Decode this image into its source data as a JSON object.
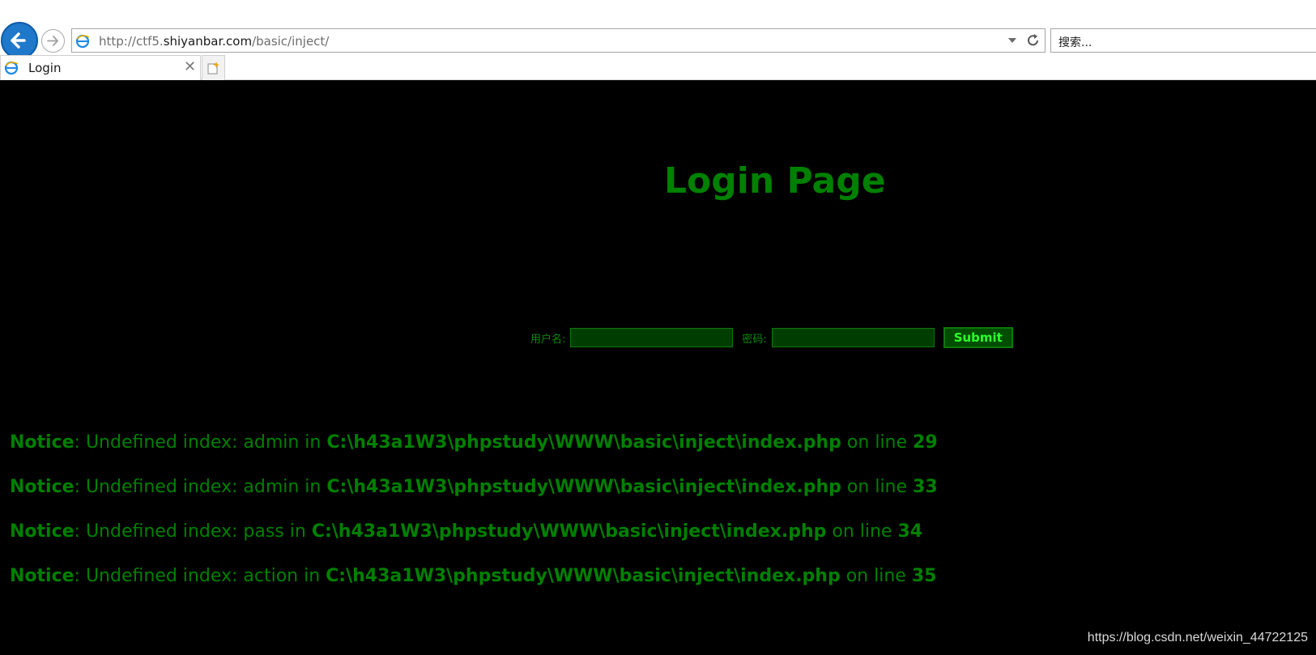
{
  "browser": {
    "address_prefix": "http://ctf5.",
    "address_host": "shiyanbar.com",
    "address_path": "/basic/inject/",
    "search_placeholder": "搜索...",
    "tab_title": "Login",
    "tab_close": "✕"
  },
  "page": {
    "title": "Login Page",
    "form": {
      "username_label": "用户名:",
      "username_value": "",
      "password_label": "密码:",
      "password_value": "",
      "submit_label": "Submit"
    },
    "notices": [
      {
        "label": "Notice",
        "text": ": Undefined index: admin in ",
        "path": "C:\\h43a1W3\\phpstudy\\WWW\\basic\\inject\\index.php",
        "mid": " on line ",
        "line": "29"
      },
      {
        "label": "Notice",
        "text": ": Undefined index: admin in ",
        "path": "C:\\h43a1W3\\phpstudy\\WWW\\basic\\inject\\index.php",
        "mid": " on line ",
        "line": "33"
      },
      {
        "label": "Notice",
        "text": ": Undefined index: pass in ",
        "path": "C:\\h43a1W3\\phpstudy\\WWW\\basic\\inject\\index.php",
        "mid": " on line ",
        "line": "34"
      },
      {
        "label": "Notice",
        "text": ": Undefined index: action in ",
        "path": "C:\\h43a1W3\\phpstudy\\WWW\\basic\\inject\\index.php",
        "mid": " on line ",
        "line": "35"
      }
    ]
  },
  "watermark": "https://blog.csdn.net/weixin_44722125",
  "colors": {
    "background": "#000000",
    "text_green": "#008000",
    "input_bg": "#003d00",
    "button_text": "#2dff2d"
  },
  "icons": [
    "back-arrow-icon",
    "forward-arrow-icon",
    "ie-favicon-icon",
    "dropdown-arrow-icon",
    "refresh-icon",
    "new-tab-icon"
  ]
}
